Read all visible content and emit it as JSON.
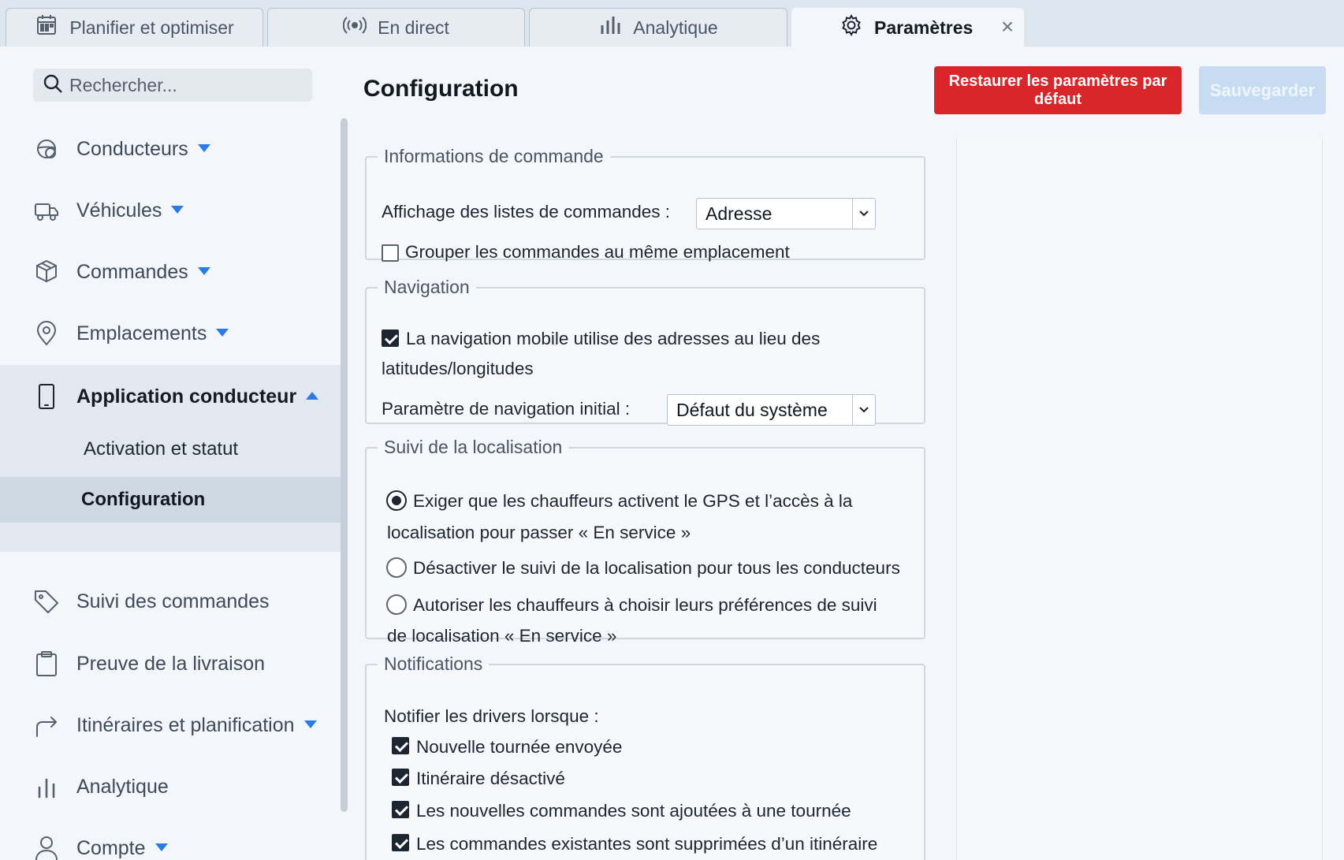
{
  "tabs": [
    {
      "label": "Planifier et optimiser",
      "icon": "calendar-icon"
    },
    {
      "label": "En direct",
      "icon": "broadcast-icon"
    },
    {
      "label": "Analytique",
      "icon": "bar-chart-icon"
    },
    {
      "label": "Paramètres",
      "icon": "gear-icon",
      "active": true
    }
  ],
  "tab_close": "×",
  "search": {
    "placeholder": "Rechercher..."
  },
  "sidebar": {
    "items": [
      {
        "label": "Conducteurs",
        "icon": "steering-wheel-icon",
        "caret": "down"
      },
      {
        "label": "Véhicules",
        "icon": "truck-icon",
        "caret": "down"
      },
      {
        "label": "Commandes",
        "icon": "box-icon",
        "caret": "down"
      },
      {
        "label": "Emplacements",
        "icon": "map-pin-icon",
        "caret": "down"
      },
      {
        "label": "Application conducteur",
        "icon": "phone-icon",
        "caret": "up"
      },
      {
        "label": "Suivi des commandes",
        "icon": "tag-icon"
      },
      {
        "label": "Preuve de la livraison",
        "icon": "clipboard-icon"
      },
      {
        "label": "Itinéraires et planification",
        "icon": "route-arrow-icon",
        "caret": "down"
      },
      {
        "label": "Analytique",
        "icon": "bar-chart-icon"
      },
      {
        "label": "Compte",
        "icon": "user-icon",
        "caret": "down"
      }
    ],
    "subitems": [
      {
        "label": "Activation et statut"
      },
      {
        "label": "Configuration",
        "selected": true
      }
    ]
  },
  "page": {
    "title": "Configuration",
    "restore_label": "Restaurer les paramètres par défaut",
    "save_label": "Sauvegarder"
  },
  "sections": {
    "order_info": {
      "legend": "Informations de commande",
      "list_display_label": "Affichage des listes de commandes :",
      "list_display_value": "Adresse",
      "group_label": "Grouper les commandes au même emplacement",
      "group_checked": false
    },
    "navigation": {
      "legend": "Navigation",
      "mobile_nav_line1": "La navigation mobile utilise des adresses au lieu des",
      "mobile_nav_line2": "latitudes/longitudes",
      "mobile_nav_checked": true,
      "initial_label": "Paramètre de navigation initial :",
      "initial_value": "Défaut du système"
    },
    "tracking": {
      "legend": "Suivi de la localisation",
      "opt1_line1": "Exiger que les chauffeurs activent le GPS et l’accès à la",
      "opt1_line2": "localisation pour passer « En service »",
      "opt2": "Désactiver le suivi de la localisation pour tous les conducteurs",
      "opt3_line1": "Autoriser les chauffeurs à choisir leurs préférences de suivi",
      "opt3_line2": "de localisation « En service »",
      "selected": 1
    },
    "notifications": {
      "legend": "Notifications",
      "intro": "Notifier les drivers lorsque :",
      "items": [
        {
          "label": "Nouvelle tournée envoyée",
          "checked": true
        },
        {
          "label": "Itinéraire désactivé",
          "checked": true
        },
        {
          "label": "Les nouvelles commandes sont ajoutées à une tournée",
          "checked": true
        },
        {
          "label": "Les commandes existantes sont supprimées d’un itinéraire",
          "checked": true
        }
      ]
    }
  },
  "colors": {
    "accent": "#2b7be5",
    "danger": "#d8262b",
    "save_disabled": "#c8dcf1",
    "selected_row": "#cfd9e4"
  }
}
